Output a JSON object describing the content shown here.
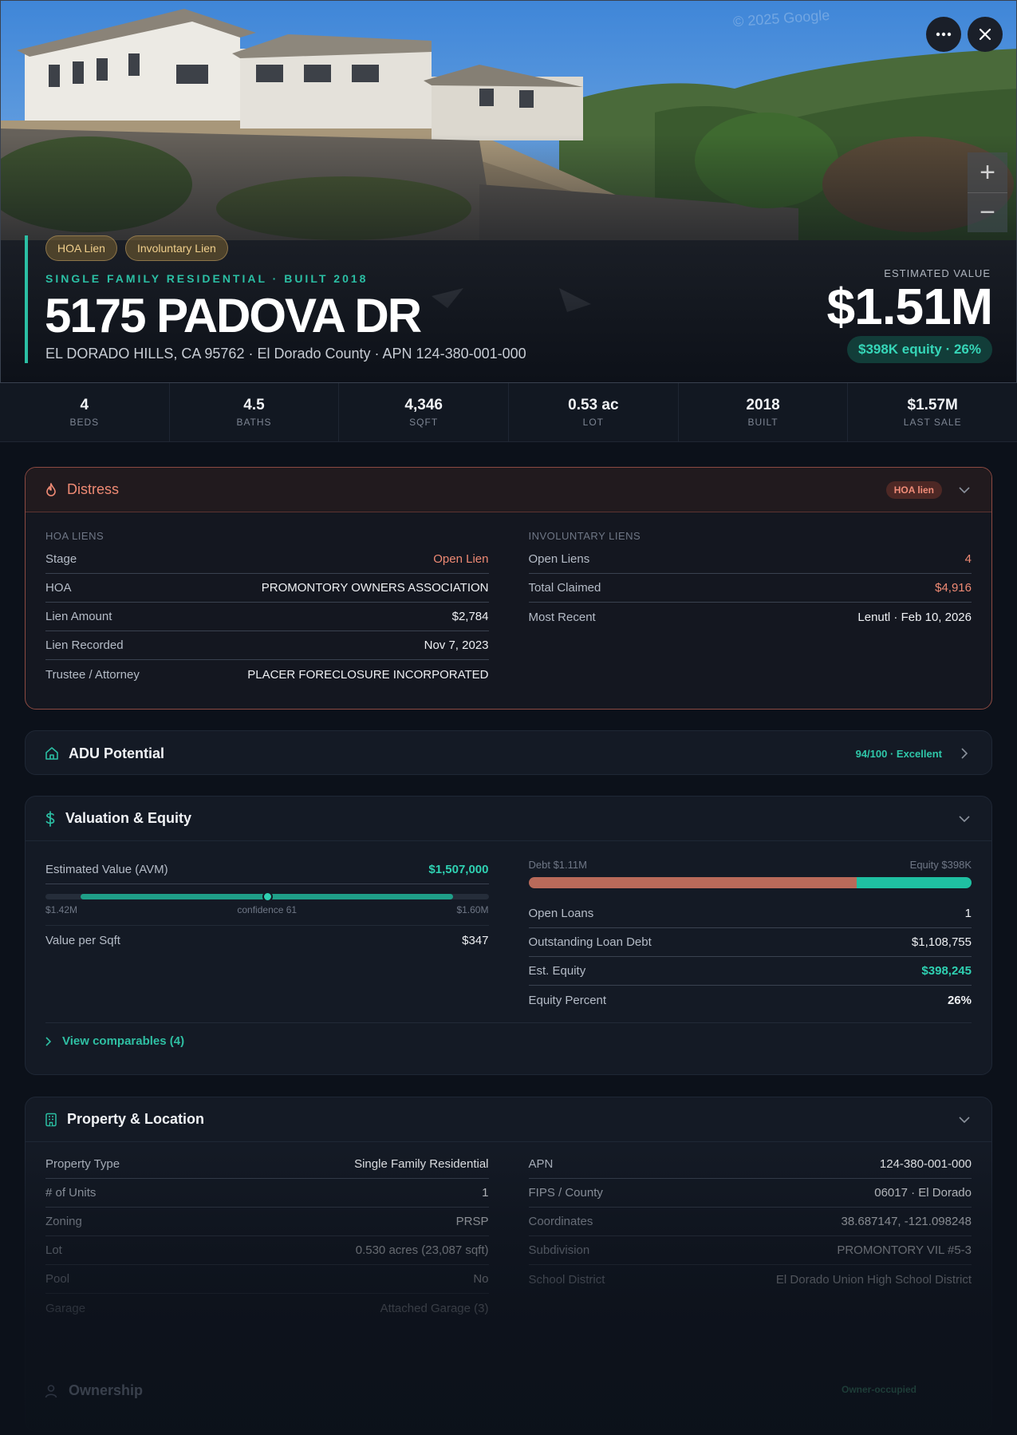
{
  "hero": {
    "watermark": "© 2025 Google",
    "chips": [
      "HOA Lien",
      "Involuntary Lien"
    ],
    "kicker": "SINGLE FAMILY RESIDENTIAL · BUILT 2018",
    "address": "5175 PADOVA DR",
    "subaddress": "EL DORADO HILLS, CA 95762 · El Dorado County · APN 124-380-001-000",
    "estimated_value_label": "ESTIMATED VALUE",
    "estimated_value": "$1.51M",
    "equity_pill": "$398K equity · 26%",
    "zoom_in": "+",
    "zoom_out": "−"
  },
  "stats": [
    {
      "value": "4",
      "label": "BEDS"
    },
    {
      "value": "4.5",
      "label": "BATHS"
    },
    {
      "value": "4,346",
      "label": "SQFT"
    },
    {
      "value": "0.53 ac",
      "label": "LOT"
    },
    {
      "value": "2018",
      "label": "BUILT"
    },
    {
      "value": "$1.57M",
      "label": "LAST SALE"
    }
  ],
  "distress": {
    "title": "Distress",
    "badge": "HOA lien",
    "hoa_label": "HOA LIENS",
    "hoa_rows": [
      {
        "k": "Stage",
        "v": "Open Lien"
      },
      {
        "k": "HOA",
        "v": "PROMONTORY OWNERS ASSOCIATION"
      },
      {
        "k": "Lien Amount",
        "v": "$2,784"
      },
      {
        "k": "Lien Recorded",
        "v": "Nov 7, 2023"
      },
      {
        "k": "Trustee / Attorney",
        "v": "PLACER FORECLOSURE INCORPORATED"
      }
    ],
    "inv_label": "INVOLUNTARY LIENS",
    "inv_rows": [
      {
        "k": "Open Liens",
        "v": "4"
      },
      {
        "k": "Total Claimed",
        "v": "$4,916"
      },
      {
        "k": "Most Recent",
        "v": "Lenutl · Feb 10, 2026"
      }
    ]
  },
  "adu": {
    "title": "ADU Potential",
    "score": "94/100 · Excellent"
  },
  "valuation": {
    "title": "Valuation & Equity",
    "avm_label": "Estimated Value (AVM)",
    "avm_value": "$1,507,000",
    "range_low": "$1.42M",
    "range_mid": "confidence 61",
    "range_high": "$1.60M",
    "range_position": 0.5,
    "vps_label": "Value per Sqft",
    "vps_value": "$347",
    "debt_label": "Debt $1.11M",
    "equity_label": "Equity $398K",
    "debt_fraction": 0.74,
    "rows": [
      {
        "k": "Open Loans",
        "v": "1"
      },
      {
        "k": "Outstanding Loan Debt",
        "v": "$1,108,755"
      },
      {
        "k": "Est. Equity",
        "v": "$398,245"
      },
      {
        "k": "Equity Percent",
        "v": "26%"
      }
    ],
    "comparables": "View comparables (4)"
  },
  "property": {
    "title": "Property & Location",
    "left_rows": [
      {
        "k": "Property Type",
        "v": "Single Family Residential"
      },
      {
        "k": "# of Units",
        "v": "1"
      },
      {
        "k": "Zoning",
        "v": "PRSP"
      },
      {
        "k": "Lot",
        "v": "0.530 acres (23,087 sqft)"
      },
      {
        "k": "Pool",
        "v": "No"
      },
      {
        "k": "Garage",
        "v": "Attached Garage (3)"
      }
    ],
    "right_rows": [
      {
        "k": "APN",
        "v": "124-380-001-000"
      },
      {
        "k": "FIPS / County",
        "v": "06017 · El Dorado"
      },
      {
        "k": "Coordinates",
        "v": "38.687147, -121.098248"
      },
      {
        "k": "Subdivision",
        "v": "PROMONTORY VIL #5-3"
      },
      {
        "k": "School District",
        "v": "El Dorado Union High School District"
      }
    ]
  },
  "ownership": {
    "title": "Ownership",
    "badge": "Owner-occupied"
  },
  "colors": {
    "accent": "#2bbfa4",
    "alert": "#ef8a74",
    "background": "#0c111a"
  }
}
